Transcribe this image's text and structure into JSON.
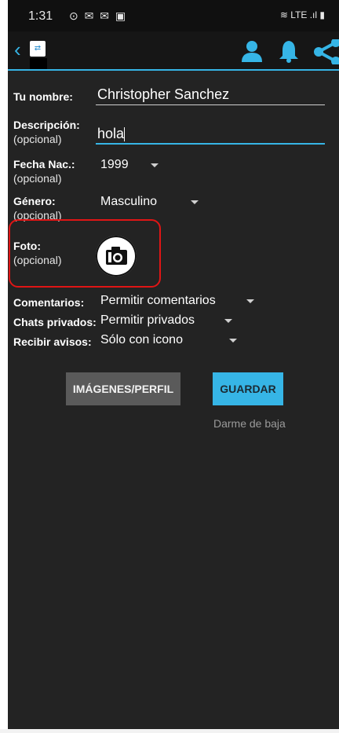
{
  "status_bar": {
    "time": "1:31",
    "left_icons": "⊙ ✉ ✉ ▣",
    "right_icons": "≋ LTE .ıl ▮"
  },
  "toolbar": {
    "back_icon": "chevron-left-icon",
    "app_logo": "app-logo",
    "icons": [
      "person-icon",
      "bell-icon",
      "share-icon"
    ]
  },
  "form": {
    "name": {
      "label": "Tu nombre:",
      "value": "Christopher Sanchez"
    },
    "description": {
      "label": "Descripción:",
      "optional": "(opcional)",
      "value": "hola"
    },
    "birth": {
      "label": "Fecha Nac.:",
      "optional": "(opcional)",
      "value": "1999"
    },
    "gender": {
      "label": "Género:",
      "optional": "(opcional)",
      "value": "Masculino"
    },
    "photo": {
      "label": "Foto:",
      "optional": "(opcional)"
    },
    "comments": {
      "label": "Comentarios:",
      "value": "Permitir comentarios"
    },
    "private_chats": {
      "label": "Chats privados:",
      "value": "Permitir privados"
    },
    "notices": {
      "label": "Recibir avisos:",
      "value": "Sólo con icono"
    }
  },
  "buttons": {
    "images_profile": "IMÁGENES/PERFIL",
    "save": "GUARDAR",
    "unsubscribe": "Darme de baja"
  },
  "colors": {
    "accent": "#36b5e6",
    "highlight": "#e01515",
    "background": "#232323"
  }
}
